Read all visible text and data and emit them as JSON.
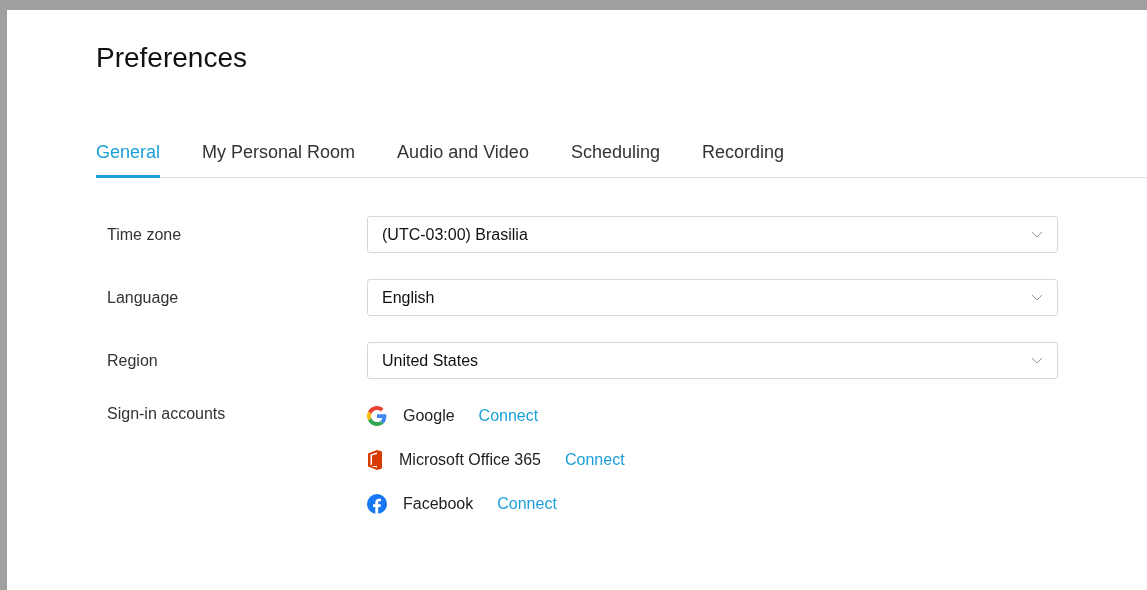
{
  "title": "Preferences",
  "tabs": [
    {
      "label": "General",
      "selected": true
    },
    {
      "label": "My Personal Room",
      "selected": false
    },
    {
      "label": "Audio and Video",
      "selected": false
    },
    {
      "label": "Scheduling",
      "selected": false
    },
    {
      "label": "Recording",
      "selected": false
    }
  ],
  "settings": [
    {
      "label": "Time zone",
      "value": "(UTC-03:00) Brasilia"
    },
    {
      "label": "Language",
      "value": "English"
    },
    {
      "label": "Region",
      "value": "United States"
    }
  ],
  "sign_in": {
    "label": "Sign-in accounts",
    "accounts": [
      {
        "kind": "google",
        "name": "Google",
        "action": "Connect"
      },
      {
        "kind": "office",
        "name": "Microsoft Office 365",
        "action": "Connect"
      },
      {
        "kind": "facebook",
        "name": "Facebook",
        "action": "Connect"
      }
    ]
  }
}
